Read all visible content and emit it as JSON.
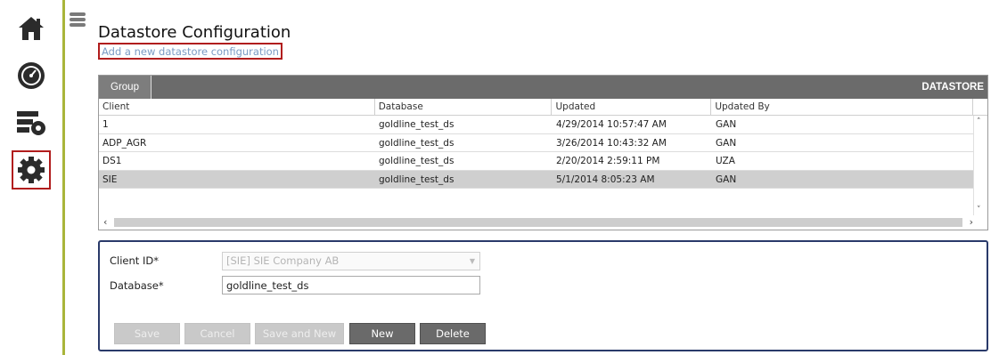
{
  "page": {
    "title": "Datastore Configuration",
    "add_link": "Add a new datastore configuration"
  },
  "rail": {
    "items": [
      {
        "icon": "home-icon"
      },
      {
        "icon": "dashboard-gauge-icon"
      },
      {
        "icon": "server-settings-icon"
      },
      {
        "icon": "gear-icon",
        "selected": true
      }
    ]
  },
  "grid": {
    "group_tab": "Group",
    "title": "DATASTORE",
    "columns": [
      "Client",
      "Database",
      "Updated",
      "Updated By"
    ],
    "rows": [
      {
        "client": "1",
        "database": "goldline_test_ds",
        "updated": "4/29/2014 10:57:47 AM",
        "updated_by": "GAN"
      },
      {
        "client": "ADP_AGR",
        "database": "goldline_test_ds",
        "updated": "3/26/2014 10:43:32 AM",
        "updated_by": "GAN"
      },
      {
        "client": "DS1",
        "database": "goldline_test_ds",
        "updated": "2/20/2014 2:59:11 PM",
        "updated_by": "UZA"
      },
      {
        "client": "SIE",
        "database": "goldline_test_ds",
        "updated": "5/1/2014 8:05:23 AM",
        "updated_by": "GAN",
        "selected": true
      }
    ]
  },
  "form": {
    "client_id_label": "Client ID*",
    "client_id_value": "[SIE] SIE Company AB",
    "database_label": "Database*",
    "database_value": "goldline_test_ds",
    "buttons": {
      "save": "Save",
      "cancel": "Cancel",
      "save_and_new": "Save and New",
      "new": "New",
      "delete": "Delete"
    }
  }
}
